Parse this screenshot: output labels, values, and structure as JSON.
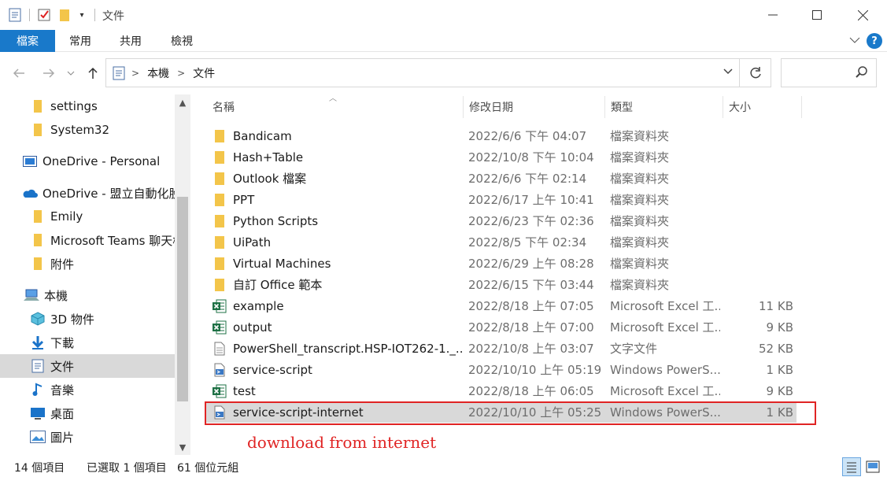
{
  "window": {
    "title": "文件"
  },
  "ribbon": {
    "file": "檔案",
    "tabs": [
      "常用",
      "共用",
      "檢視"
    ],
    "help": "?"
  },
  "address": {
    "segments": [
      "本機",
      "文件"
    ]
  },
  "search": {
    "placeholder": ""
  },
  "sidebar": {
    "items": [
      {
        "label": "settings",
        "icon": "folder-icon"
      },
      {
        "label": "System32",
        "icon": "folder-icon"
      },
      {
        "label": "OneDrive - Personal",
        "icon": "onedrive-personal-icon"
      },
      {
        "label": "OneDrive - 盟立自動化股",
        "icon": "onedrive-cloud-icon"
      },
      {
        "label": "Emily",
        "icon": "folder-icon"
      },
      {
        "label": "Microsoft Teams 聊天檔",
        "icon": "folder-icon"
      },
      {
        "label": "附件",
        "icon": "folder-icon"
      },
      {
        "label": "本機",
        "icon": "this-pc-icon"
      },
      {
        "label": "3D 物件",
        "icon": "3d-objects-icon"
      },
      {
        "label": "下載",
        "icon": "downloads-icon"
      },
      {
        "label": "文件",
        "icon": "documents-icon"
      },
      {
        "label": "音樂",
        "icon": "music-icon"
      },
      {
        "label": "桌面",
        "icon": "desktop-icon"
      },
      {
        "label": "圖片",
        "icon": "pictures-icon"
      }
    ]
  },
  "columns": {
    "name": "名稱",
    "modified": "修改日期",
    "type": "類型",
    "size": "大小"
  },
  "files": [
    {
      "name": "Bandicam",
      "modified": "2022/6/6 下午 04:07",
      "type": "檔案資料夾",
      "size": "",
      "icon": "folder-icon"
    },
    {
      "name": "Hash+Table",
      "modified": "2022/10/8 下午 10:04",
      "type": "檔案資料夾",
      "size": "",
      "icon": "folder-icon"
    },
    {
      "name": "Outlook 檔案",
      "modified": "2022/6/6 下午 02:14",
      "type": "檔案資料夾",
      "size": "",
      "icon": "folder-icon"
    },
    {
      "name": "PPT",
      "modified": "2022/6/17 上午 10:41",
      "type": "檔案資料夾",
      "size": "",
      "icon": "folder-icon"
    },
    {
      "name": "Python Scripts",
      "modified": "2022/6/23 下午 02:36",
      "type": "檔案資料夾",
      "size": "",
      "icon": "folder-icon"
    },
    {
      "name": "UiPath",
      "modified": "2022/8/5 下午 02:34",
      "type": "檔案資料夾",
      "size": "",
      "icon": "folder-icon"
    },
    {
      "name": "Virtual Machines",
      "modified": "2022/6/29 上午 08:28",
      "type": "檔案資料夾",
      "size": "",
      "icon": "folder-icon"
    },
    {
      "name": "自訂 Office 範本",
      "modified": "2022/6/15 下午 03:44",
      "type": "檔案資料夾",
      "size": "",
      "icon": "folder-icon"
    },
    {
      "name": "example",
      "modified": "2022/8/18 上午 07:05",
      "type": "Microsoft Excel 工...",
      "size": "11 KB",
      "icon": "excel-icon"
    },
    {
      "name": "output",
      "modified": "2022/8/18 上午 07:00",
      "type": "Microsoft Excel 工...",
      "size": "9 KB",
      "icon": "excel-icon"
    },
    {
      "name": "PowerShell_transcript.HSP-IOT262-1._...",
      "modified": "2022/10/8 上午 03:07",
      "type": "文字文件",
      "size": "52 KB",
      "icon": "text-file-icon"
    },
    {
      "name": "service-script",
      "modified": "2022/10/10 上午 05:19",
      "type": "Windows PowerS...",
      "size": "1 KB",
      "icon": "powershell-icon"
    },
    {
      "name": "test",
      "modified": "2022/8/18 上午 06:05",
      "type": "Microsoft Excel 工...",
      "size": "9 KB",
      "icon": "excel-icon"
    },
    {
      "name": "service-script-internet",
      "modified": "2022/10/10 上午 05:25",
      "type": "Windows PowerS...",
      "size": "1 KB",
      "icon": "powershell-icon"
    }
  ],
  "annotation": {
    "text": "download from internet",
    "color": "#e02424"
  },
  "status": {
    "count": "14 個項目",
    "selected": "已選取 1 個項目",
    "size": "61 個位元組"
  },
  "colors": {
    "accent": "#1979ca",
    "selection": "#d9d9d9",
    "folder": "#f3c54a",
    "excel": "#1e7145"
  }
}
